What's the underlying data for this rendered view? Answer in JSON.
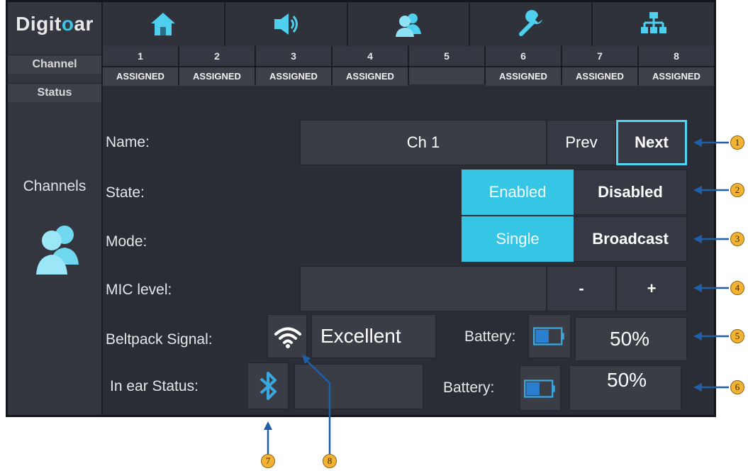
{
  "app": {
    "logo_text_a": "Digit",
    "logo_text_b": "o",
    "logo_text_c": "ar"
  },
  "sidebar": {
    "channel_label": "Channel",
    "status_label": "Status",
    "section_label": "Channels",
    "section_icon": "users-icon"
  },
  "nav": {
    "tabs": [
      {
        "icon": "home-icon"
      },
      {
        "icon": "speaker-icon"
      },
      {
        "icon": "users-icon"
      },
      {
        "icon": "wrench-icon"
      },
      {
        "icon": "network-icon"
      }
    ]
  },
  "channels": [
    {
      "number": "1",
      "status": "ASSIGNED"
    },
    {
      "number": "2",
      "status": "ASSIGNED"
    },
    {
      "number": "3",
      "status": "ASSIGNED"
    },
    {
      "number": "4",
      "status": "ASSIGNED"
    },
    {
      "number": "5",
      "status": ""
    },
    {
      "number": "6",
      "status": "ASSIGNED"
    },
    {
      "number": "7",
      "status": "ASSIGNED"
    },
    {
      "number": "8",
      "status": "ASSIGNED"
    }
  ],
  "form": {
    "name_label": "Name:",
    "name_value": "Ch 1",
    "prev_label": "Prev",
    "next_label": "Next",
    "state_label": "State:",
    "state_options": [
      "Enabled",
      "Disabled"
    ],
    "state_selected": "Enabled",
    "mode_label": "Mode:",
    "mode_options": [
      "Single",
      "Broadcast"
    ],
    "mode_selected": "Single",
    "mic_label": "MIC level:",
    "mic_minus": "-",
    "mic_plus": "+",
    "beltpack_label": "Beltpack Signal:",
    "beltpack_signal": "Excellent",
    "beltpack_battery_label": "Battery:",
    "beltpack_battery": "50%",
    "inear_label": "In ear  Status:",
    "inear_battery_label": "Battery:",
    "inear_battery": "50%"
  },
  "callouts": [
    "1",
    "2",
    "3",
    "4",
    "5",
    "6",
    "7",
    "8"
  ],
  "colors": {
    "accent": "#35c6e6",
    "callout": "#f2b233",
    "arrow": "#1f5ea8"
  }
}
